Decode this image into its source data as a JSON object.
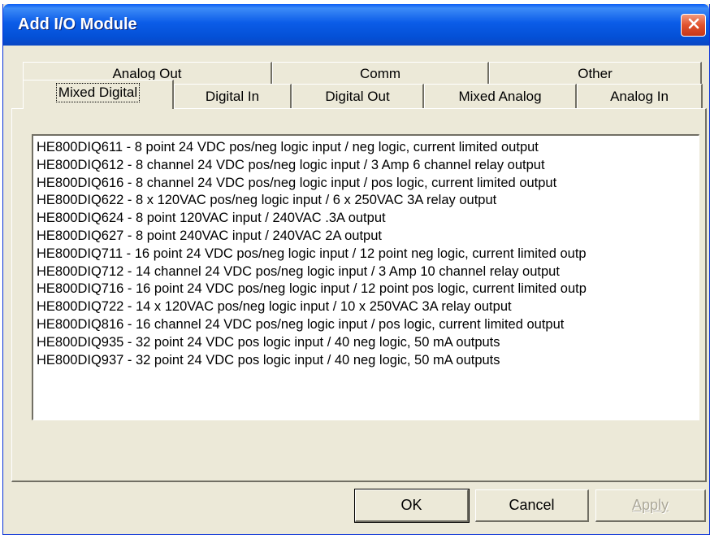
{
  "window": {
    "title": "Add I/O Module"
  },
  "tabs": {
    "row1": [
      {
        "label": "Analog Out"
      },
      {
        "label": "Comm"
      },
      {
        "label": "Other"
      }
    ],
    "row2": [
      {
        "label": "Mixed Digital",
        "active": true
      },
      {
        "label": "Digital In"
      },
      {
        "label": "Digital Out"
      },
      {
        "label": "Mixed Analog"
      },
      {
        "label": "Analog In"
      }
    ]
  },
  "modules": [
    "HE800DIQ611  -  8 point 24 VDC pos/neg logic input / neg logic, current limited output",
    "HE800DIQ612  -  8 channel 24 VDC pos/neg logic input / 3 Amp 6 channel relay output",
    "HE800DIQ616  -  8 channel 24 VDC pos/neg logic input / pos logic, current limited output",
    "HE800DIQ622  -  8 x 120VAC pos/neg logic input / 6 x 250VAC 3A relay output",
    "HE800DIQ624  -  8 point 120VAC input / 240VAC .3A output",
    "HE800DIQ627  -  8 point 240VAC input / 240VAC 2A output",
    "HE800DIQ711  -  16 point 24 VDC pos/neg logic input / 12 point neg logic, current limited outp",
    "HE800DIQ712  -  14 channel 24 VDC pos/neg logic input / 3 Amp 10 channel relay output",
    "HE800DIQ716  -  16 point 24 VDC pos/neg logic input / 12 point pos logic, current limited outp",
    "HE800DIQ722  -  14 x 120VAC pos/neg logic input / 10 x 250VAC 3A relay output",
    "HE800DIQ816  -  16 channel 24 VDC pos/neg logic input / pos logic, current limited output",
    "HE800DIQ935  -  32 point 24 VDC pos logic input / 40 neg logic, 50 mA outputs",
    "HE800DIQ937  -  32 point 24 VDC pos logic input / 40 neg logic, 50 mA outputs"
  ],
  "buttons": {
    "ok": "OK",
    "cancel": "Cancel",
    "apply": "Apply"
  },
  "colors": {
    "titlebar": "#0a5ef5",
    "dialog_face": "#ece9d8",
    "close_button": "#e1522c"
  }
}
